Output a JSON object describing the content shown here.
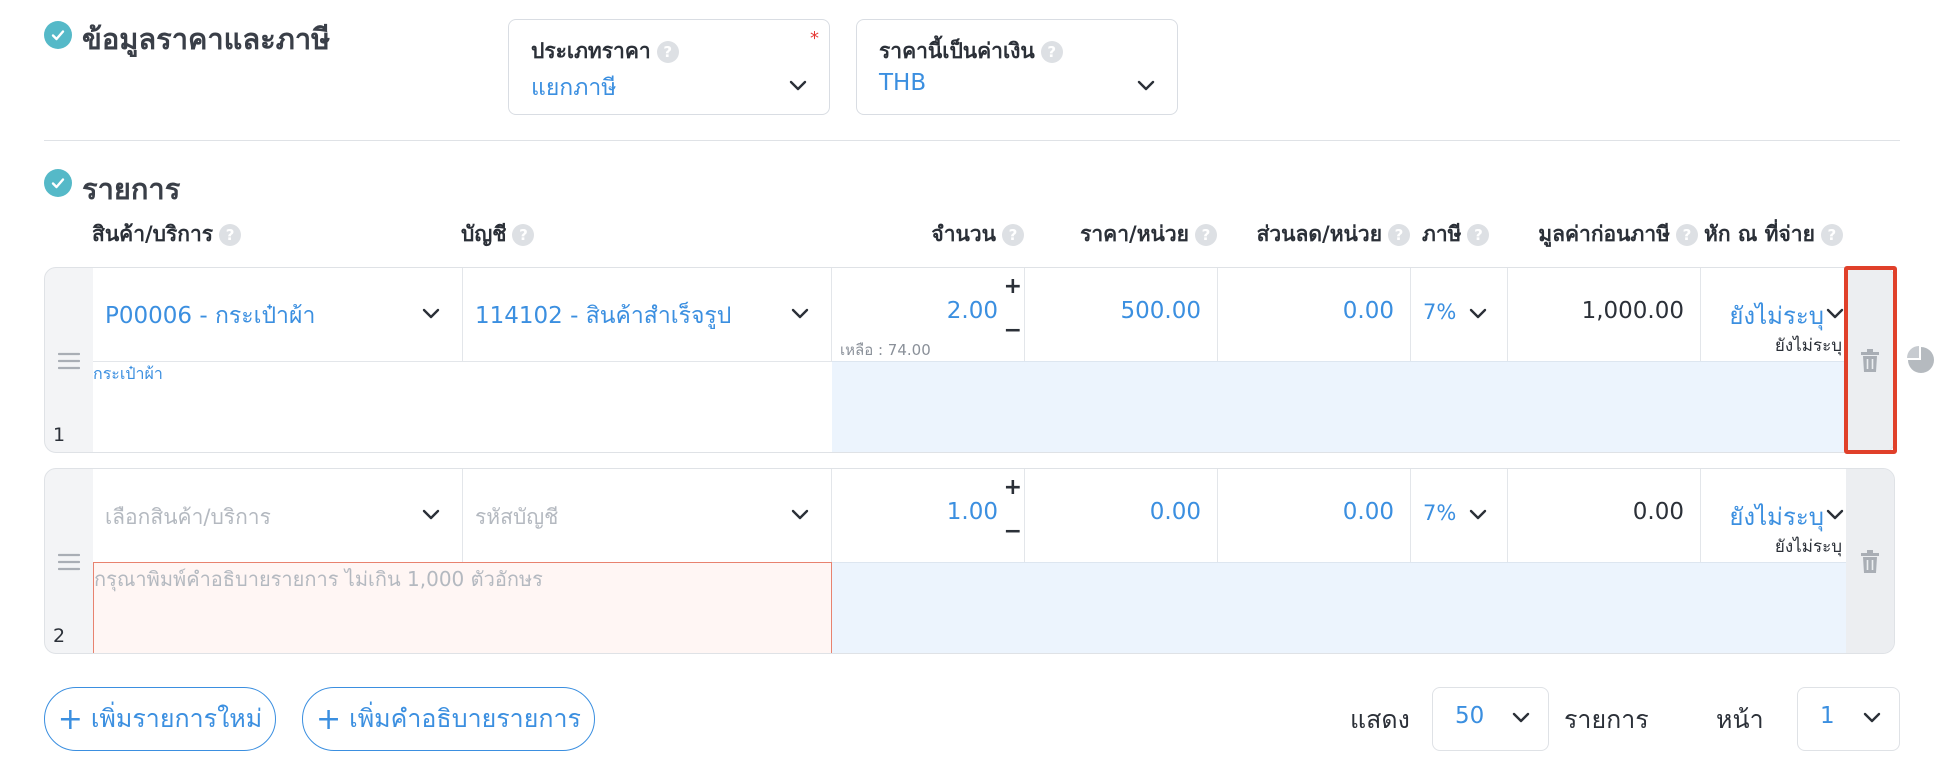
{
  "price_section": {
    "title": "ข้อมูลราคาและภาษี",
    "price_type": {
      "label": "ประเภทราคา",
      "value": "แยกภาษี",
      "required_mark": "*"
    },
    "currency": {
      "label": "ราคานี้เป็นค่าเงิน",
      "value": "THB"
    }
  },
  "items_section": {
    "title": "รายการ",
    "columns": {
      "product": "สินค้า/บริการ",
      "account": "บัญชี",
      "qty": "จำนวน",
      "unit_price": "ราคา/หน่วย",
      "discount": "ส่วนลด/หน่วย",
      "tax": "ภาษี",
      "pre_tax": "มูลค่าก่อนภาษี",
      "withholding": "หัก ณ ที่จ่าย"
    },
    "help_glyph": "?",
    "rows": [
      {
        "number": "1",
        "product": "P00006 - กระเป๋าผ้า",
        "account": "114102 - สินค้าสำเร็จรูป",
        "qty": "2.00",
        "remaining": "เหลือ : 74.00",
        "unit_price": "500.00",
        "discount": "0.00",
        "tax": "7%",
        "pre_tax": "1,000.00",
        "withholding": "ยังไม่ระบุ",
        "withholding_sub": "ยังไม่ระบุ",
        "description": "กระเป๋าผ้า",
        "plus": "+",
        "minus": "−"
      },
      {
        "number": "2",
        "product_placeholder": "เลือกสินค้า/บริการ",
        "account_placeholder": "รหัสบัญชี",
        "qty": "1.00",
        "unit_price": "0.00",
        "discount": "0.00",
        "tax": "7%",
        "pre_tax": "0.00",
        "withholding": "ยังไม่ระบุ",
        "withholding_sub": "ยังไม่ระบุ",
        "description_placeholder": "กรุณาพิมพ์คำอธิบายรายการ ไม่เกิน 1,000 ตัวอักษร",
        "plus": "+",
        "minus": "−"
      }
    ]
  },
  "footer": {
    "add_item": "เพิ่มรายการใหม่",
    "add_description": "เพิ่มคำอธิบายรายการ",
    "plus": "+",
    "show_label": "แสดง",
    "page_size": "50",
    "items_label": "รายการ",
    "page_label": "หน้า",
    "page": "1"
  },
  "colors": {
    "accent": "#3b8fe0",
    "check": "#55b9c8",
    "highlight": "#e0402a",
    "error": "#e53935"
  }
}
